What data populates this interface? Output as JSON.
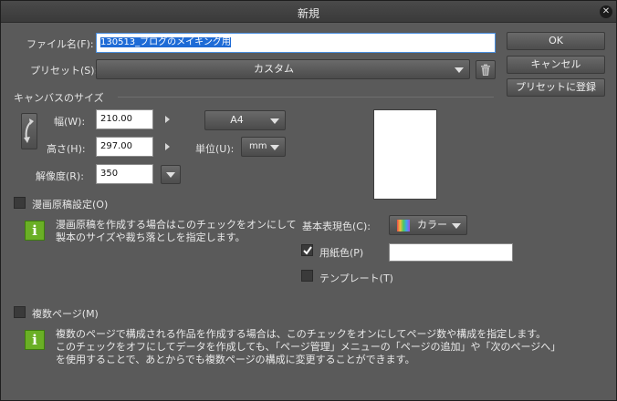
{
  "window": {
    "title": "新規",
    "close_glyph": "✕"
  },
  "file_name": {
    "label": "ファイル名(F):",
    "value": "130513_ブログのメイキング用"
  },
  "preset": {
    "label": "プリセット(S):",
    "value": "カスタム"
  },
  "buttons": {
    "ok": "OK",
    "cancel": "キャンセル",
    "register_preset": "プリセットに登録"
  },
  "canvas_size": {
    "section": "キャンバスのサイズ",
    "width_label": "幅(W):",
    "width_value": "210.00",
    "height_label": "高さ(H):",
    "height_value": "297.00",
    "resolution_label": "解像度(R):",
    "resolution_value": "350",
    "paper_size": "A4",
    "unit_label": "単位(U):",
    "unit_value": "mm"
  },
  "manga": {
    "checkbox_label": "漫画原稿設定(O)",
    "info_line1": "漫画原稿を作成する場合はこのチェックをオンにして",
    "info_line2": "製本のサイズや裁ち落としを指定します。"
  },
  "color": {
    "basic_color_label": "基本表現色(C):",
    "basic_color_value": "カラー",
    "paper_color_label": "用紙色(P)",
    "paper_color_checked": true,
    "paper_color": "#ffffff",
    "template_label": "テンプレート(T)"
  },
  "multipage": {
    "checkbox_label": "複数ページ(M)",
    "info_line1": "複数のページで構成される作品を作成する場合は、このチェックをオンにしてページ数や構成を指定します。",
    "info_line2": "このチェックをオフにしてデータを作成しても、「ページ管理」メニューの「ページの追加」や「次のページへ」",
    "info_line3": "を使用することで、あとからでも複数ページの構成に変更することができます。"
  },
  "icons": [
    "close-icon",
    "trash-icon",
    "rotate-orientation-icon",
    "chevron-right-icon",
    "chevron-down-icon",
    "color-swatch-icon",
    "info-icon",
    "checkmark-icon"
  ]
}
